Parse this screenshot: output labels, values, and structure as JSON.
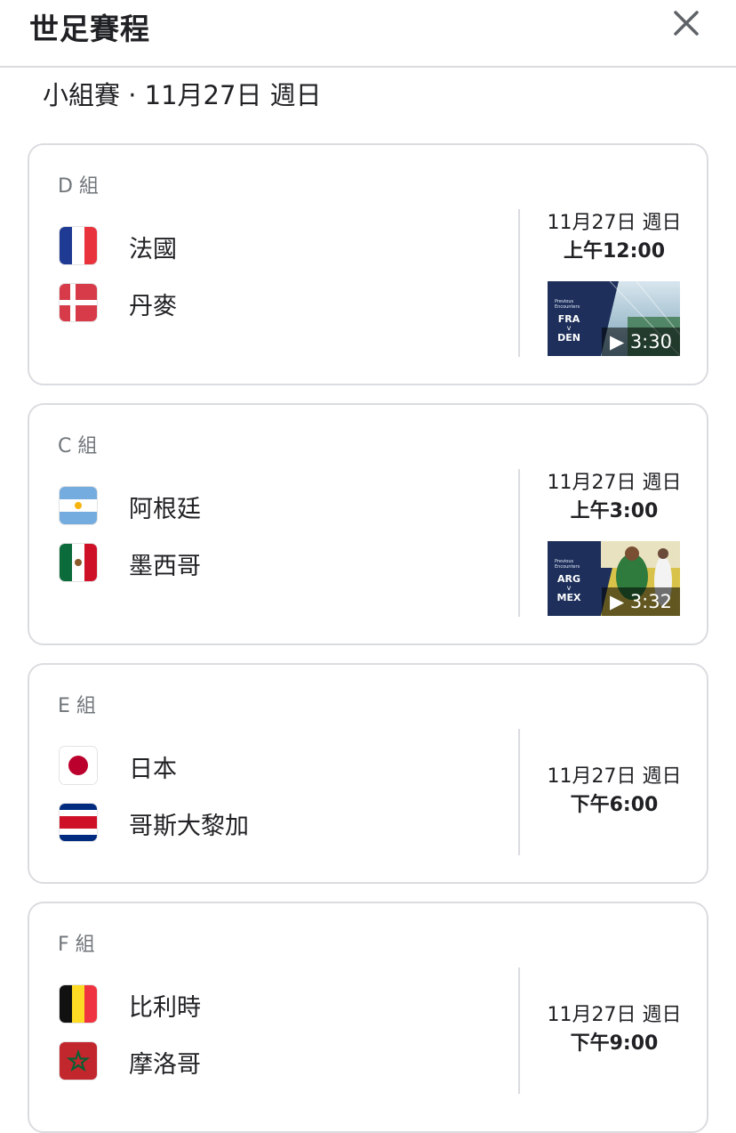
{
  "header": {
    "title": "世足賽程",
    "close_icon": "close-icon"
  },
  "subtitle": "小組賽 · 11月27日 週日",
  "matches": [
    {
      "group": "D 組",
      "team1": {
        "name": "法國",
        "flag": "france-flag-icon"
      },
      "team2": {
        "name": "丹麥",
        "flag": "denmark-flag-icon"
      },
      "date": "11月27日 週日",
      "time": "上午12:00",
      "video": {
        "team1": "FRA",
        "vs": "v",
        "team2": "DEN",
        "duration": "▶ 3:30",
        "caption": "Previous Encounters"
      }
    },
    {
      "group": "C 組",
      "team1": {
        "name": "阿根廷",
        "flag": "argentina-flag-icon"
      },
      "team2": {
        "name": "墨西哥",
        "flag": "mexico-flag-icon"
      },
      "date": "11月27日 週日",
      "time": "上午3:00",
      "video": {
        "team1": "ARG",
        "vs": "v",
        "team2": "MEX",
        "duration": "▶ 3:32",
        "caption": "Previous Encounters"
      }
    },
    {
      "group": "E 組",
      "team1": {
        "name": "日本",
        "flag": "japan-flag-icon"
      },
      "team2": {
        "name": "哥斯大黎加",
        "flag": "costa-rica-flag-icon"
      },
      "date": "11月27日 週日",
      "time": "下午6:00"
    },
    {
      "group": "F 組",
      "team1": {
        "name": "比利時",
        "flag": "belgium-flag-icon"
      },
      "team2": {
        "name": "摩洛哥",
        "flag": "morocco-flag-icon"
      },
      "date": "11月27日 週日",
      "time": "下午9:00"
    }
  ],
  "colors": {
    "border": "#dadce0",
    "muted_text": "#70757a",
    "text": "#202124"
  }
}
